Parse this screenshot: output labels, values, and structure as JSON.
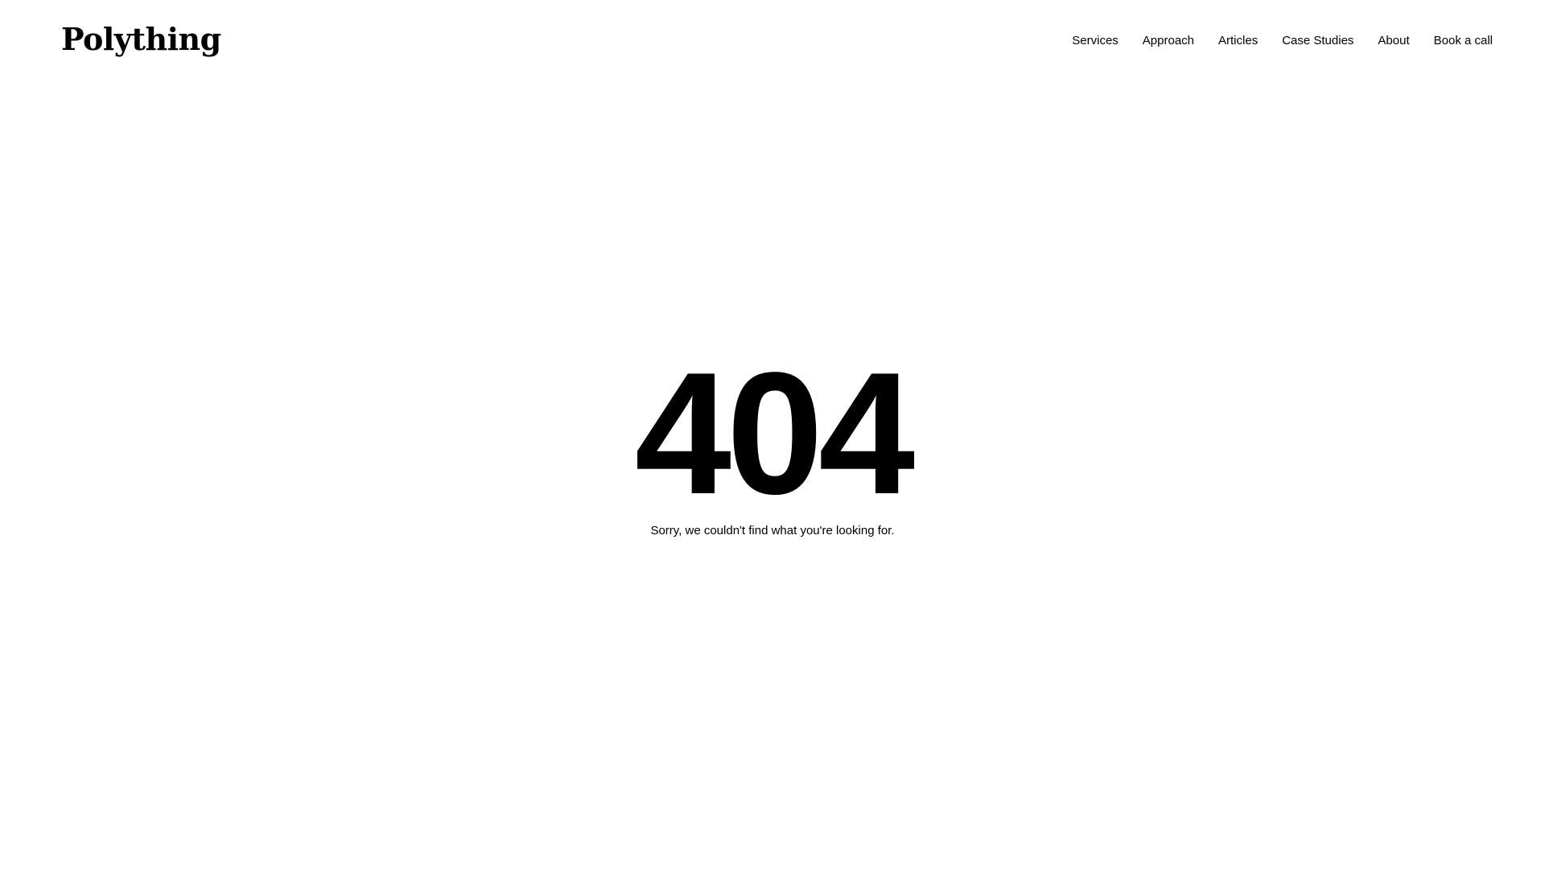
{
  "header": {
    "logo_text": "Polything",
    "nav": {
      "services": "Services",
      "approach": "Approach",
      "articles": "Articles",
      "case_studies": "Case Studies",
      "about": "About",
      "book_call": "Book a call"
    }
  },
  "main": {
    "error_code": "404",
    "error_message": "Sorry, we couldn't find what you're looking for."
  },
  "colors": {
    "background": "#ffffff",
    "text": "#000000"
  }
}
